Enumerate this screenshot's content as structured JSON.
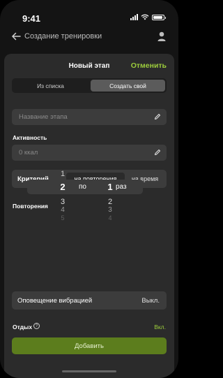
{
  "status_bar": {
    "time": "9:41",
    "icons": [
      "signal-icon",
      "wifi-icon",
      "battery-icon"
    ]
  },
  "header": {
    "title": "Создание тренировки",
    "back_icon": "arrow-left-icon",
    "profile_icon": "user-icon"
  },
  "sheet": {
    "title": "Новый этап",
    "cancel_label": "Отменить",
    "segments": [
      {
        "label": "Из списка",
        "selected": false
      },
      {
        "label": "Создать свой",
        "selected": true
      }
    ],
    "name_field": {
      "placeholder": "Название этапа",
      "icon": "pencil-icon"
    },
    "activity_label": "Активность",
    "activity_field": {
      "placeholder": "0 ккал",
      "icon": "pencil-icon"
    },
    "criterion": {
      "label": "Критерий",
      "options": [
        {
          "label": "на повторения",
          "selected": true
        },
        {
          "label": "на время",
          "selected": false
        }
      ]
    },
    "reps_label": "Повторения",
    "picker": {
      "from_column": {
        "above": "1",
        "selected": "2",
        "below": [
          "3",
          "4",
          "5"
        ]
      },
      "separator": "по",
      "to_column": {
        "above": "",
        "selected": "1",
        "below": [
          "2",
          "3",
          "4"
        ]
      },
      "unit": "раз"
    },
    "vibration": {
      "label": "Оповещение вибрацией",
      "value": "Выкл."
    },
    "rest": {
      "label": "Отдых",
      "help_icon": "question-circle-icon",
      "value": "Вкл."
    },
    "add_button": "Добавить"
  },
  "colors": {
    "accent": "#9ccc3c",
    "button": "#5c7d1d",
    "sheet": "#2b2b2b",
    "field": "#3c3c3c"
  }
}
